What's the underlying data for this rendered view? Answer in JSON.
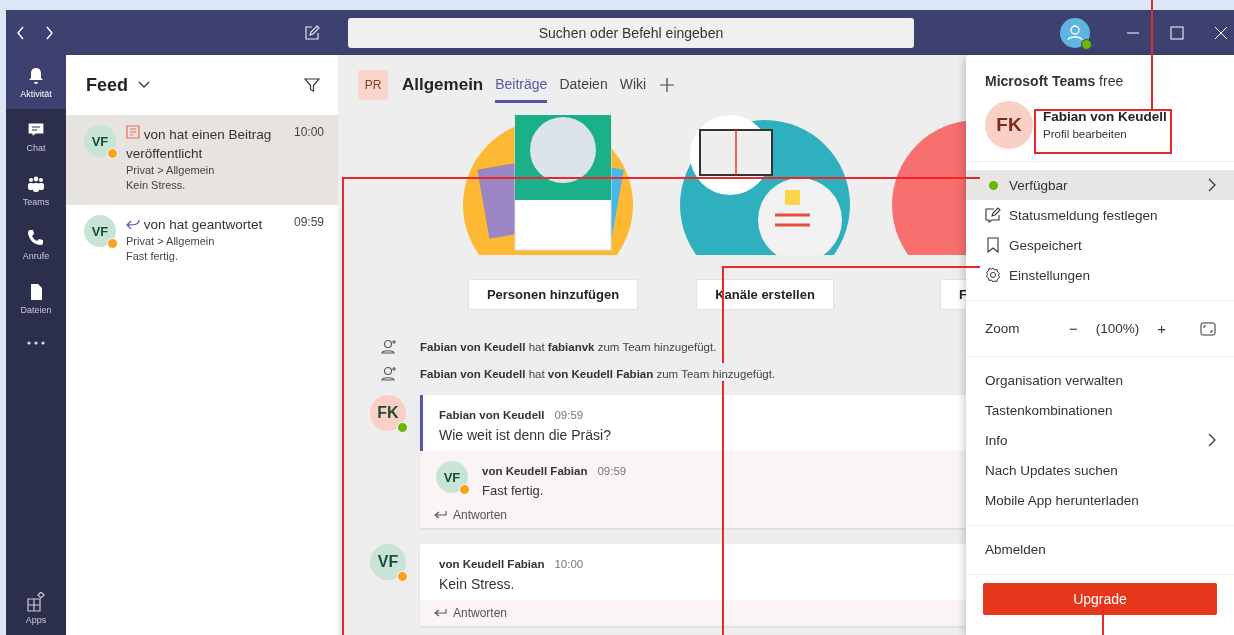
{
  "titlebar": {
    "search_placeholder": "Suchen oder Befehl eingeben",
    "away": false
  },
  "rail": [
    {
      "label": "Aktivität",
      "selected": true
    },
    {
      "label": "Chat",
      "selected": false
    },
    {
      "label": "Teams",
      "selected": false
    },
    {
      "label": "Anrufe",
      "selected": false
    },
    {
      "label": "Dateien",
      "selected": false
    }
  ],
  "rail_bottom": {
    "label": "Apps"
  },
  "feed": {
    "title": "Feed",
    "items": [
      {
        "initials": "VF",
        "color": "#c8e4d6",
        "away": true,
        "kind": "post",
        "text": "von hat einen Beitrag veröffentlicht",
        "time": "10:00",
        "path": "Privat > Allgemein",
        "preview": "Kein Stress.",
        "selected": true
      },
      {
        "initials": "VF",
        "color": "#c8e4d6",
        "away": true,
        "kind": "reply",
        "text": "von hat geantwortet",
        "time": "09:59",
        "path": "Privat > Allgemein",
        "preview": "Fast fertig.",
        "selected": false
      }
    ]
  },
  "channel": {
    "initials": "PR",
    "name": "Allgemein",
    "tabs": [
      {
        "label": "Beiträge",
        "selected": true
      },
      {
        "label": "Dateien",
        "selected": false
      },
      {
        "label": "Wiki",
        "selected": false
      }
    ]
  },
  "actions": [
    "Personen hinzufügen",
    "Kanäle erstellen",
    "F"
  ],
  "events": [
    "**Fabian von Keudell** hat **fabianvk** zum Team hinzugefügt.",
    "**Fabian von Keudell** hat **von Keudell Fabian** zum Team hinzugefügt."
  ],
  "threads": [
    {
      "initials": "FK",
      "color": "#f9cfc6",
      "away": false,
      "author": "Fabian von Keudell",
      "time": "09:59",
      "text": "Wie weit ist denn die Präsi?",
      "unread": true,
      "reply_label": "Antworten",
      "replies": [
        {
          "initials": "VF",
          "color": "#c8e4d6",
          "away": true,
          "author": "von Keudell Fabian",
          "time": "09:59",
          "text": "Fast fertig."
        }
      ]
    },
    {
      "initials": "VF",
      "color": "#c8e4d6",
      "away": true,
      "author": "von Keudell Fabian",
      "time": "10:00",
      "text": "Kein Stress.",
      "unread": false,
      "reply_label": "Antworten"
    }
  ],
  "menu": {
    "product": "**Microsoft Teams** free",
    "initials": "FK",
    "color": "#f9cfc6",
    "name": "Fabian von Keudell",
    "profile_link": "Profil bearbeiten",
    "status_items": [
      {
        "label": "Verfügbar",
        "kind": "status",
        "selected": true,
        "submenu": true
      },
      {
        "label": "Statusmeldung festlegen",
        "kind": "message",
        "selected": false,
        "submenu": false
      },
      {
        "label": "Gespeichert",
        "kind": "saved",
        "selected": false,
        "submenu": false
      },
      {
        "label": "Einstellungen",
        "kind": "settings",
        "selected": false,
        "submenu": false
      }
    ],
    "zoom": {
      "label": "Zoom",
      "minus": "−",
      "value": "(100%)",
      "plus": "+"
    },
    "items": [
      {
        "label": "Organisation verwalten",
        "submenu": false
      },
      {
        "label": "Tastenkombinationen",
        "submenu": false
      },
      {
        "label": "Info",
        "submenu": true
      },
      {
        "label": "Nach Updates suchen",
        "submenu": false
      },
      {
        "label": "Mobile App herunterladen",
        "submenu": false
      }
    ],
    "signout": "Abmelden",
    "upgrade": "Upgrade"
  }
}
